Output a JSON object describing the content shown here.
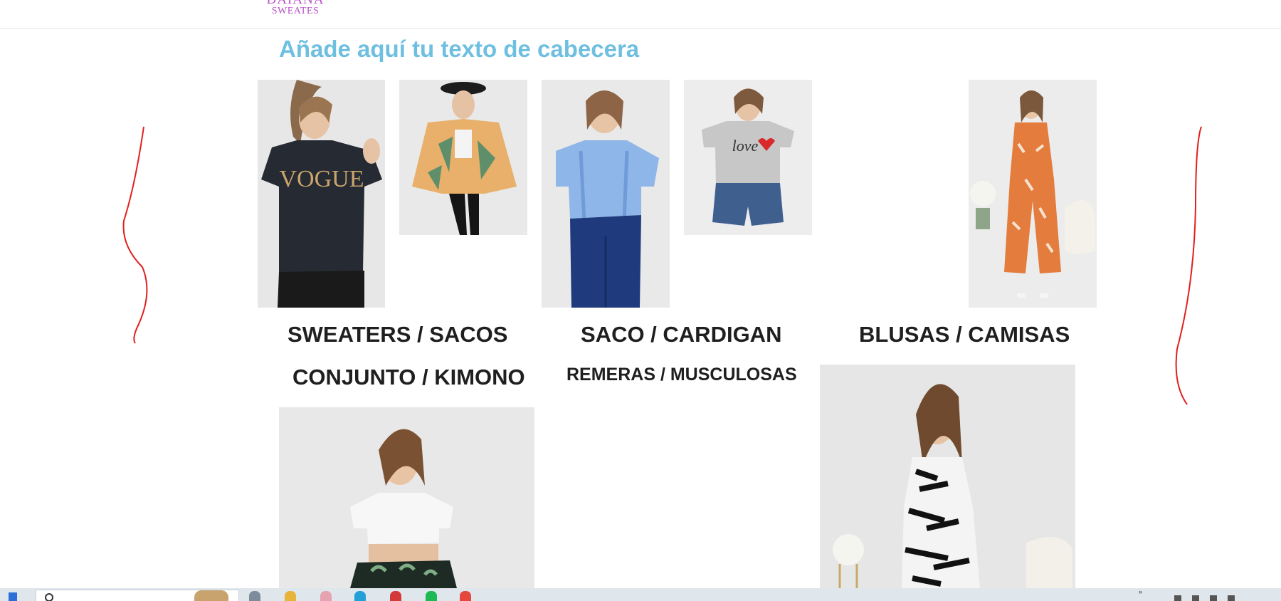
{
  "header": {
    "logo_line1": "DAIANA",
    "logo_line2": "SWEATES"
  },
  "main": {
    "headline": "Añade aquí tu texto de cabecera",
    "categories": [
      "SWEATERS / SACOS",
      "SACO / CARDIGAN",
      "BLUSAS / CAMISAS",
      "CONJUNTO / KIMONO",
      "REMERAS / MUSCULOSAS"
    ]
  },
  "product_photos": [
    {
      "icon": "photo-black-vogue-tee",
      "print": "VOGUE"
    },
    {
      "icon": "photo-floral-kimono"
    },
    {
      "icon": "photo-blue-ruffle-blouse"
    },
    {
      "icon": "photo-grey-love-tee",
      "print": "love"
    },
    {
      "icon": "photo-orange-jumpsuit"
    },
    {
      "icon": "photo-white-crop-top"
    },
    {
      "icon": "photo-zebra-dress"
    }
  ],
  "colors": {
    "headline": "#6ebfe0",
    "logo": "#b74fc7",
    "annotation": "#e0201e",
    "category_text": "#1f1f1f"
  }
}
